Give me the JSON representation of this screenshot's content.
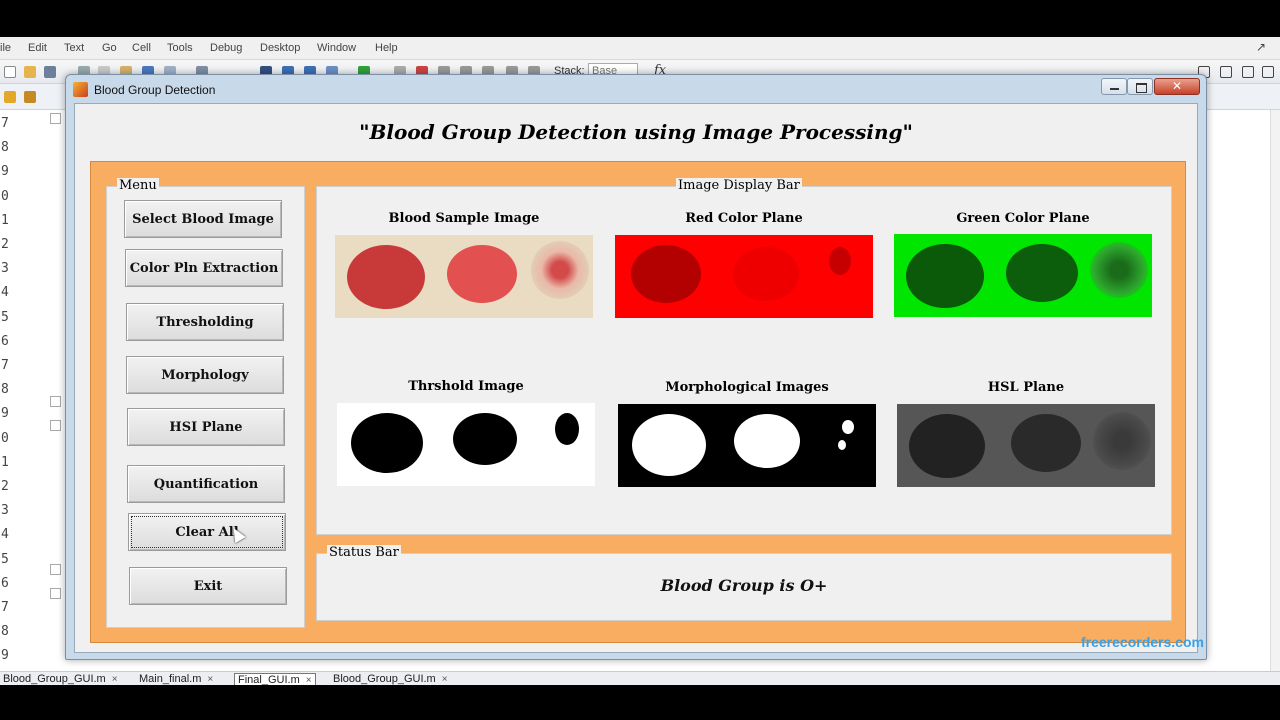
{
  "editor": {
    "menu": [
      "ile",
      "Edit",
      "Text",
      "Go",
      "Cell",
      "Tools",
      "Debug",
      "Desktop",
      "Window",
      "Help"
    ],
    "stack_label": "Stack:",
    "stack_value": "Base",
    "fx_label": "fx",
    "line_numbers": [
      "7",
      "8",
      "9",
      "0",
      "1",
      "2",
      "3",
      "4",
      "5",
      "6",
      "7",
      "8",
      "9",
      "0",
      "1",
      "2",
      "3",
      "4",
      "5",
      "6",
      "7",
      "8",
      "9"
    ],
    "tabs": [
      {
        "label": "Blood_Group_GUI.m",
        "active": false
      },
      {
        "label": "Main_final.m",
        "active": false
      },
      {
        "label": "Final_GUI.m",
        "active": true
      },
      {
        "label": "Blood_Group_GUI.m",
        "active": false
      }
    ],
    "tab_close": "×"
  },
  "window": {
    "title": "Blood Group Detection",
    "close_symbol": "✕"
  },
  "main_title": "\"Blood Group Detection using Image Processing\"",
  "menu": {
    "legend": "Menu",
    "buttons": [
      "Select Blood Image",
      "Color Pln Extraction",
      "Thresholding",
      "Morphology",
      "HSI Plane",
      "Quantification",
      "Clear All",
      "Exit"
    ]
  },
  "display": {
    "legend": "Image Display Bar",
    "images": [
      {
        "label": "Blood Sample Image",
        "icon": "blood-sample-image"
      },
      {
        "label": "Red Color Plane",
        "icon": "red-plane-image"
      },
      {
        "label": "Green Color Plane",
        "icon": "green-plane-image"
      },
      {
        "label": "Thrshold Image",
        "icon": "threshold-image"
      },
      {
        "label": "Morphological Images",
        "icon": "morphology-image"
      },
      {
        "label": "HSL Plane",
        "icon": "hsl-plane-image"
      }
    ]
  },
  "status": {
    "legend": "Status Bar",
    "text": "Blood Group is O+"
  },
  "watermark": "freerecorders.com",
  "colors": {
    "panel_orange": "#f9ad61",
    "red_plane": "#ff0000",
    "green_plane": "#00e600"
  }
}
